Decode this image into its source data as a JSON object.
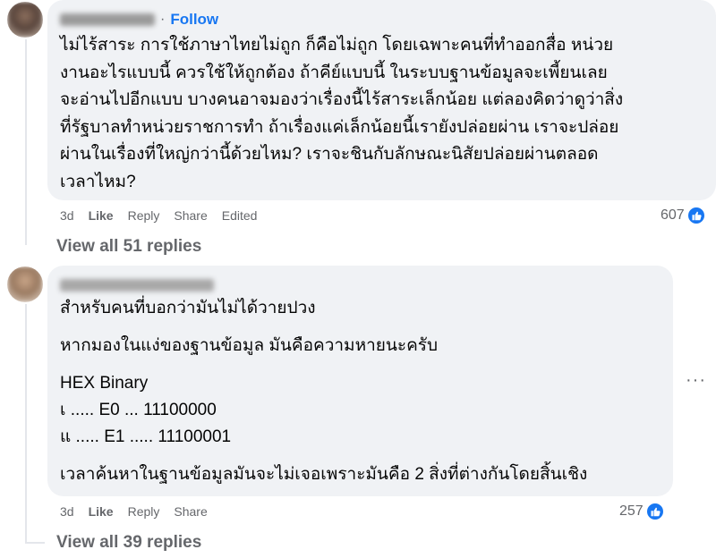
{
  "comment1": {
    "follow_label": "Follow",
    "lines": [
      "ไม่ไร้สาระ การใช้ภาษาไทยไม่ถูก ก็คือไม่ถูก โดยเฉพาะคนที่ทำออกสื่อ หน่วย",
      "งานอะไรแบบนี้ ควรใช้ให้ถูกต้อง ถ้าคีย์แบบนี้ ในระบบฐานข้อมูลจะเพี้ยนเลย",
      "จะอ่านไปอีกแบบ บางคนอาจมองว่าเรื่องนี้ไร้สาระเล็กน้อย แต่ลองคิดว่าดูว่าสิ่ง",
      "ที่รัฐบาลทำหน่วยราชการทำ ถ้าเรื่องแค่เล็กน้อยนี้เรายังปล่อยผ่าน เราจะปล่อย",
      "ผ่านในเรื่องที่ใหญ่กว่านี้ด้วยไหม? เราจะชินกับลักษณะนิสัยปล่อยผ่านตลอด",
      "เวลาไหม?"
    ],
    "actions": {
      "time": "3d",
      "like": "Like",
      "reply": "Reply",
      "share": "Share",
      "edited": "Edited"
    },
    "reaction_count": "607",
    "view_replies": "View all 51 replies"
  },
  "comment2": {
    "lines": [
      "สำหรับคนที่บอกว่ามันไม่ได้วายปวง",
      "หากมองในแง่ของฐานข้อมูล มันคือความหายนะครับ",
      "HEX Binary",
      "เ ..... E0 ... 11100000",
      "แ ..... E1 ..... 11100001",
      "เวลาค้นหาในฐานข้อมูลมันจะไม่เจอเพราะมันคือ 2 สิ่งที่ต่างกันโดยสิ้นเชิง"
    ],
    "actions": {
      "time": "3d",
      "like": "Like",
      "reply": "Reply",
      "share": "Share"
    },
    "reaction_count": "257",
    "more_icon": "more-horizontal-icon",
    "view_replies": "View all 39 replies"
  },
  "colors": {
    "accent": "#1877f2",
    "bubble": "#f0f2f5",
    "muted": "#65676b"
  }
}
